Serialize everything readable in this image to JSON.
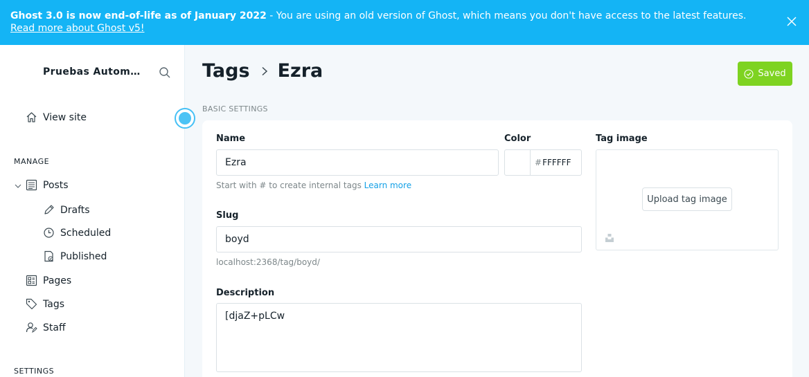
{
  "banner": {
    "bold_text": "Ghost 3.0 is now end-of-life as of January 2022",
    "text": " - You are using an old version of Ghost, which means you don't have access to the latest features. ",
    "link_text": "Read more about Ghost v5!",
    "close_icon": "close-icon",
    "background_color": "#14b4f5"
  },
  "sidebar": {
    "blog_title": "Pruebas Automatizadas",
    "view_site": "View site",
    "manage_label": "MANAGE",
    "items": [
      {
        "label": "Posts",
        "icon": "posts-icon"
      },
      {
        "label": "Drafts",
        "icon": "pencil-icon"
      },
      {
        "label": "Scheduled",
        "icon": "clock-icon"
      },
      {
        "label": "Published",
        "icon": "published-icon"
      },
      {
        "label": "Pages",
        "icon": "pages-icon"
      },
      {
        "label": "Tags",
        "icon": "tag-icon"
      },
      {
        "label": "Staff",
        "icon": "staff-icon"
      }
    ],
    "settings_label": "SETTINGS"
  },
  "header": {
    "breadcrumb_parent": "Tags",
    "breadcrumb_current": "Ezra",
    "saved_label": "Saved",
    "saved_color": "#7ed321"
  },
  "form": {
    "section_heading": "BASIC SETTINGS",
    "name_label": "Name",
    "name_value": "Ezra",
    "name_hint": "Start with # to create internal tags ",
    "name_hint_link": "Learn more",
    "color_label": "Color",
    "color_hash": "#",
    "color_value": "FFFFFF",
    "image_label": "Tag image",
    "upload_label": "Upload tag image",
    "slug_label": "Slug",
    "slug_value": "boyd",
    "slug_url": "localhost:2368/tag/boyd/",
    "description_label": "Description",
    "description_value": "[djaZ+pLCw"
  }
}
